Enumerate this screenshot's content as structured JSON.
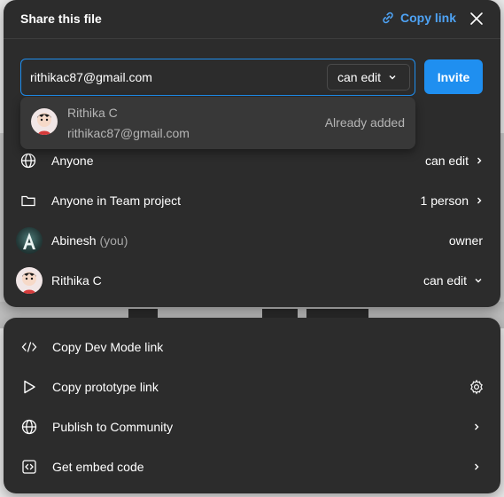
{
  "header": {
    "title": "Share this file",
    "copy_link_label": "Copy link"
  },
  "invite": {
    "email_value": "rithikac87@gmail.com",
    "permission": "can edit",
    "invite_label": "Invite"
  },
  "suggestion": {
    "name": "Rithika C",
    "email": "rithikac87@gmail.com",
    "status": "Already added"
  },
  "access": [
    {
      "label": "Anyone",
      "value": "can edit"
    },
    {
      "label": "Anyone in Team project",
      "value": "1 person"
    },
    {
      "label": "Abinesh",
      "suffix": "(you)",
      "value": "owner"
    },
    {
      "label": "Rithika C",
      "value": "can edit"
    }
  ],
  "actions": [
    {
      "label": "Copy Dev Mode link"
    },
    {
      "label": "Copy prototype link"
    },
    {
      "label": "Publish to Community"
    },
    {
      "label": "Get embed code"
    }
  ],
  "colors": {
    "accent": "#1f8ff0",
    "link": "#4ea3f5",
    "panel": "#2c2c2c",
    "muted": "#b5b5b5"
  }
}
